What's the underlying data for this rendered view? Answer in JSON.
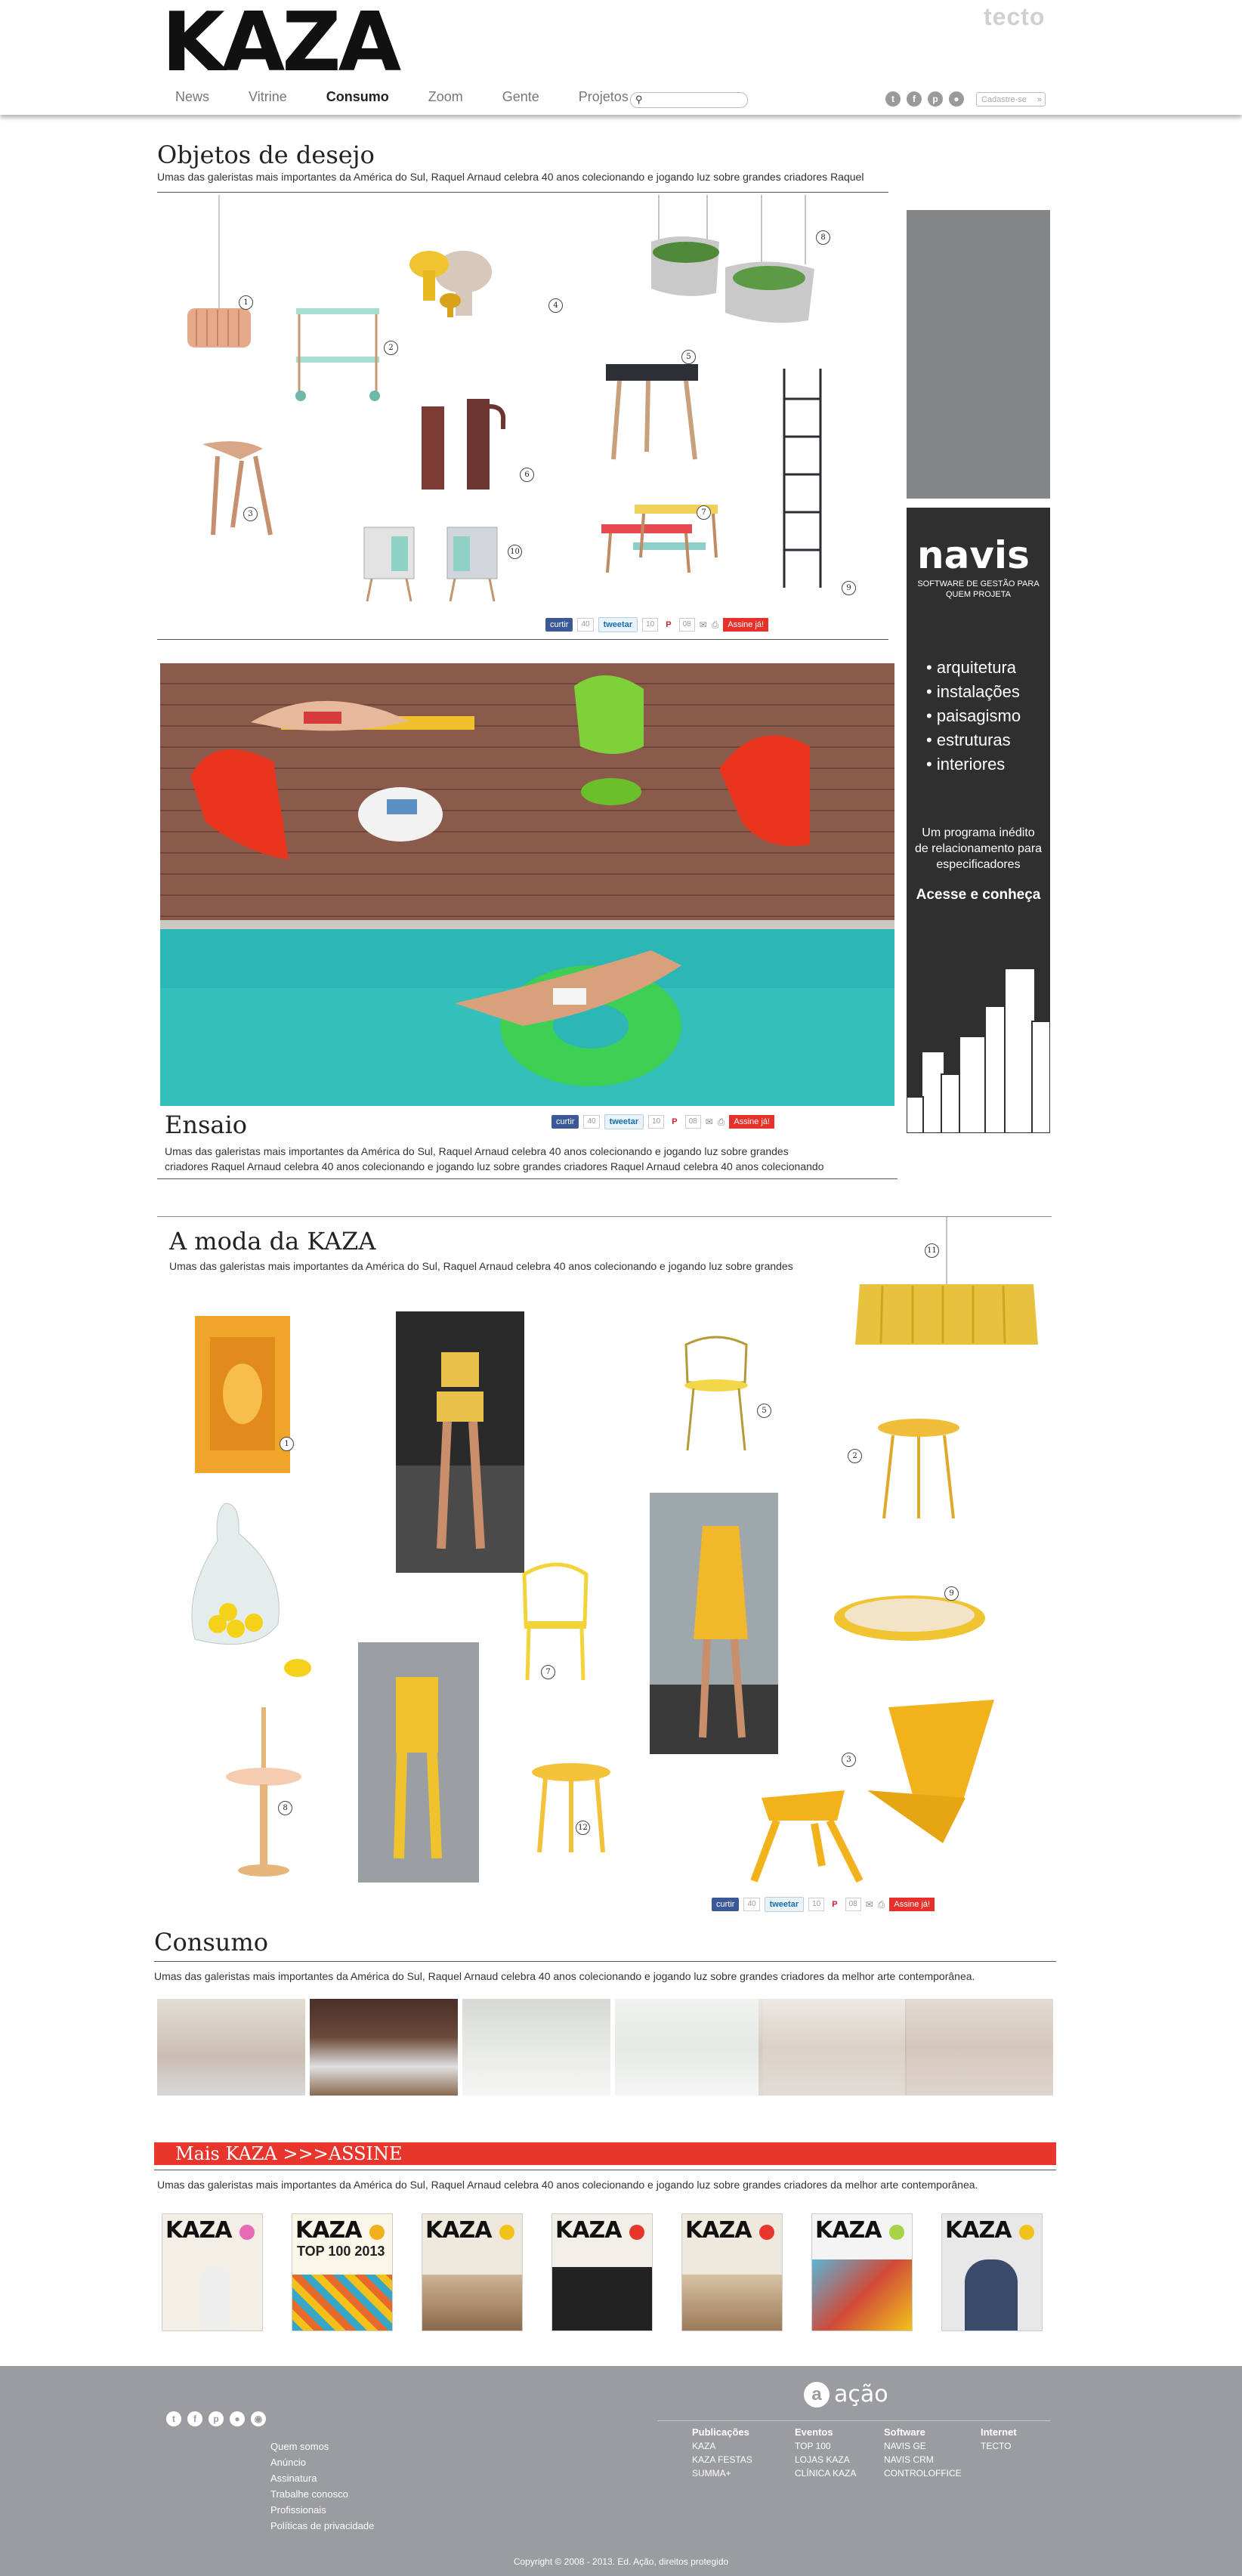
{
  "header": {
    "logo": "KAZA",
    "partner": "tecto",
    "nav": [
      "News",
      "Vitrine",
      "Consumo",
      "Zoom",
      "Gente",
      "Projetos"
    ],
    "nav_active": "Consumo",
    "search_placeholder": "",
    "subscribe_placeholder": "Cadastre-se",
    "social": [
      "twitter-icon",
      "facebook-icon",
      "pinterest-icon",
      "instagram-icon"
    ]
  },
  "objetos": {
    "title": "Objetos de desejo",
    "lead": "Umas das galeristas mais importantes da América do Sul, Raquel Arnaud celebra 40 anos colecionando e jogando luz sobre grandes criadores Raquel",
    "numbers": [
      "1",
      "2",
      "3",
      "4",
      "5",
      "6",
      "7",
      "8",
      "9",
      "10"
    ]
  },
  "share": {
    "curtir": "curtir",
    "tweetar": "tweetar",
    "fb_count": "40",
    "tw_count": "10",
    "pin_count": "08",
    "assine": "Assine já!"
  },
  "ensaio": {
    "title": "Ensaio",
    "lead": "Umas das galeristas mais importantes da América do Sul, Raquel Arnaud celebra 40 anos colecionando e jogando luz sobre grandes criadores Raquel Arnaud celebra 40 anos colecionando e jogando luz sobre grandes criadores Raquel Arnaud celebra 40 anos colecionando"
  },
  "ad": {
    "brand": "navis",
    "tagline": "SOFTWARE DE GESTÃO PARA QUEM PROJETA",
    "items": [
      "arquitetura",
      "instalações",
      "paisagismo",
      "estruturas",
      "interiores"
    ],
    "body": "Um programa inédito de relacionamento para especificadores",
    "cta": "Acesse e conheça"
  },
  "moda": {
    "title": "A moda da KAZA",
    "lead": "Umas das galeristas mais importantes da América do Sul, Raquel Arnaud celebra 40 anos colecionando e jogando luz sobre grandes",
    "numbers": [
      "1",
      "2",
      "3",
      "5",
      "7",
      "8",
      "9",
      "11",
      "12"
    ]
  },
  "consumo": {
    "title": "Consumo",
    "lead": "Umas das galeristas mais importantes da América do Sul, Raquel Arnaud celebra 40 anos colecionando e jogando luz sobre grandes criadores da melhor arte contemporânea."
  },
  "mais": {
    "title": "Mais KAZA >>>ASSINE",
    "lead": "Umas das galeristas mais importantes da América do Sul, Raquel Arnaud celebra 40 anos colecionando e jogando luz sobre grandes criadores da melhor arte contemporânea.",
    "covers": [
      "KAZA",
      "KAZA",
      "KAZA",
      "KAZA",
      "KAZA",
      "KAZA",
      "KAZA"
    ],
    "cover2_text": "TOP 100 2013"
  },
  "footer": {
    "brand": "ação",
    "links": [
      "Quem somos",
      "Anúncio",
      "Assinatura",
      "Trabalhe conosco",
      "Profissionais",
      "Políticas de privacidade"
    ],
    "col1_h": "Publicações",
    "col1": [
      "KAZA",
      "KAZA FESTAS",
      "SUMMA+"
    ],
    "col2_h": "Eventos",
    "col2": [
      "TOP 100",
      "LOJAS KAZA",
      "CLÍNICA KAZA"
    ],
    "col3_h": "Software",
    "col3": [
      "NAVIS GE",
      "NAVIS CRM",
      "CONTROLOFFICE"
    ],
    "col4_h": "Internet",
    "col4": [
      "TECTO"
    ],
    "copyright": "Copyright © 2008 - 2013. Ed. Ação, direitos protegido"
  }
}
